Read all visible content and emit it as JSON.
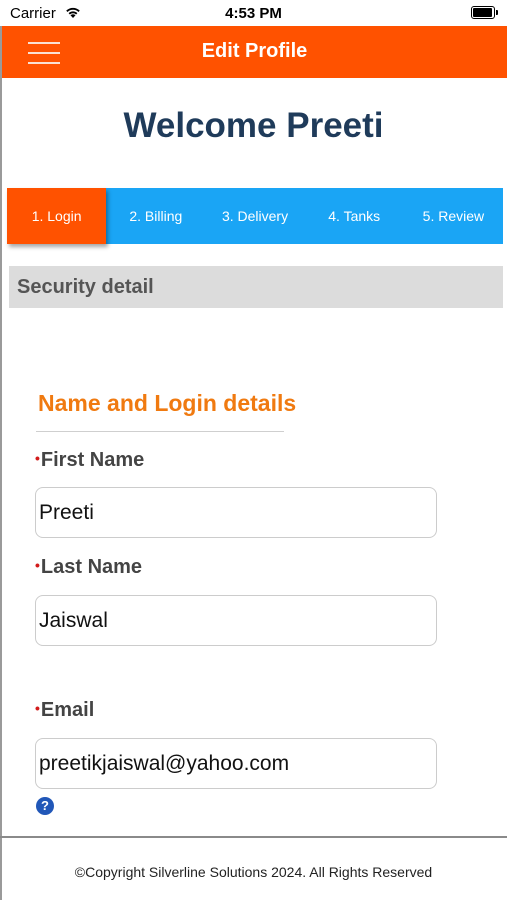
{
  "status_bar": {
    "carrier": "Carrier",
    "time": "4:53 PM"
  },
  "header": {
    "title": "Edit Profile"
  },
  "welcome": "Welcome Preeti",
  "steps": [
    {
      "label": "1. Login",
      "active": true
    },
    {
      "label": "2. Billing",
      "active": false
    },
    {
      "label": "3. Delivery",
      "active": false
    },
    {
      "label": "4. Tanks",
      "active": false
    },
    {
      "label": "5. Review",
      "active": false
    }
  ],
  "section": {
    "title": "Security detail"
  },
  "form": {
    "group_title": "Name and Login details",
    "first_name": {
      "label": "First Name",
      "value": "Preeti"
    },
    "last_name": {
      "label": "Last Name",
      "value": "Jaiswal"
    },
    "email": {
      "label": "Email",
      "value": "preetikjaiswal@yahoo.com"
    },
    "required_mark": "•",
    "help_glyph": "?"
  },
  "footer": {
    "copyright": "©Copyright Silverline Solutions 2024. All Rights Reserved"
  },
  "colors": {
    "accent_orange": "#ff5200",
    "step_blue": "#1aa5f5",
    "welcome_navy": "#1f3b5a",
    "group_title_orange": "#f07a10"
  }
}
